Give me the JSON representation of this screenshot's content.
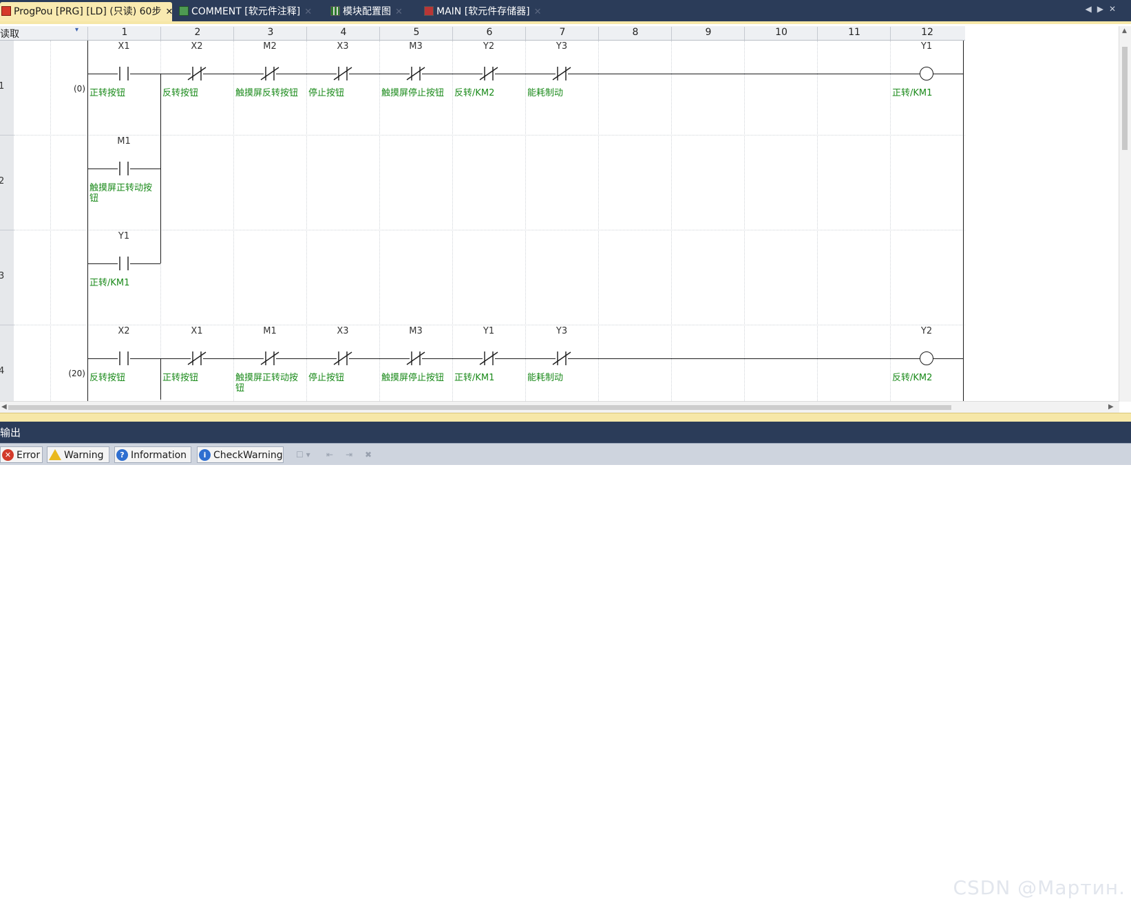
{
  "tabs": [
    {
      "label": "ProgPou [PRG] [LD] (只读) 60步",
      "icon": "ladder-program-icon",
      "active": true
    },
    {
      "label": "COMMENT [软元件注释]",
      "icon": "comment-icon",
      "active": false
    },
    {
      "label": "模块配置图",
      "icon": "module-config-icon",
      "active": false
    },
    {
      "label": "MAIN [软元件存储器]",
      "icon": "device-memory-icon",
      "active": false
    }
  ],
  "header": {
    "mode_label": "读取",
    "columns": [
      "1",
      "2",
      "3",
      "4",
      "5",
      "6",
      "7",
      "8",
      "9",
      "10",
      "11",
      "12"
    ]
  },
  "rungs": [
    {
      "row": "1",
      "step": "(0)"
    },
    {
      "row": "2",
      "step": ""
    },
    {
      "row": "3",
      "step": ""
    },
    {
      "row": "4",
      "step": "(20)"
    }
  ],
  "contacts": [
    {
      "rung": 0,
      "col": 1,
      "type": "NO",
      "name": "X1",
      "comment": "正转按钮"
    },
    {
      "rung": 0,
      "col": 2,
      "type": "NC",
      "name": "X2",
      "comment": "反转按钮"
    },
    {
      "rung": 0,
      "col": 3,
      "type": "NC",
      "name": "M2",
      "comment": "触摸屏反转按钮"
    },
    {
      "rung": 0,
      "col": 4,
      "type": "NC",
      "name": "X3",
      "comment": "停止按钮"
    },
    {
      "rung": 0,
      "col": 5,
      "type": "NC",
      "name": "M3",
      "comment": "触摸屏停止按钮"
    },
    {
      "rung": 0,
      "col": 6,
      "type": "NC",
      "name": "Y2",
      "comment": "反转/KM2"
    },
    {
      "rung": 0,
      "col": 7,
      "type": "NC",
      "name": "Y3",
      "comment": "能耗制动"
    },
    {
      "rung": 1,
      "col": 1,
      "type": "NO",
      "name": "M1",
      "comment": "触摸屏正转动按钮"
    },
    {
      "rung": 2,
      "col": 1,
      "type": "NO",
      "name": "Y1",
      "comment": "正转/KM1"
    },
    {
      "rung": 3,
      "col": 1,
      "type": "NO",
      "name": "X2",
      "comment": "反转按钮"
    },
    {
      "rung": 3,
      "col": 2,
      "type": "NC",
      "name": "X1",
      "comment": "正转按钮"
    },
    {
      "rung": 3,
      "col": 3,
      "type": "NC",
      "name": "M1",
      "comment": "触摸屏正转动按钮"
    },
    {
      "rung": 3,
      "col": 4,
      "type": "NC",
      "name": "X3",
      "comment": "停止按钮"
    },
    {
      "rung": 3,
      "col": 5,
      "type": "NC",
      "name": "M3",
      "comment": "触摸屏停止按钮"
    },
    {
      "rung": 3,
      "col": 6,
      "type": "NC",
      "name": "Y1",
      "comment": "正转/KM1"
    },
    {
      "rung": 3,
      "col": 7,
      "type": "NC",
      "name": "Y3",
      "comment": "能耗制动"
    }
  ],
  "coils": [
    {
      "rung": 0,
      "col": 12,
      "name": "Y1",
      "comment": "正转/KM1"
    },
    {
      "rung": 3,
      "col": 12,
      "name": "Y2",
      "comment": "反转/KM2"
    }
  ],
  "output": {
    "title": "输出",
    "buttons": [
      {
        "label": "Error",
        "icon": "error-icon"
      },
      {
        "label": "Warning",
        "icon": "warning-icon"
      },
      {
        "label": "Information",
        "icon": "information-icon"
      },
      {
        "label": "CheckWarning",
        "icon": "check-warning-icon"
      }
    ]
  },
  "watermark": "CSDN @Мартин."
}
